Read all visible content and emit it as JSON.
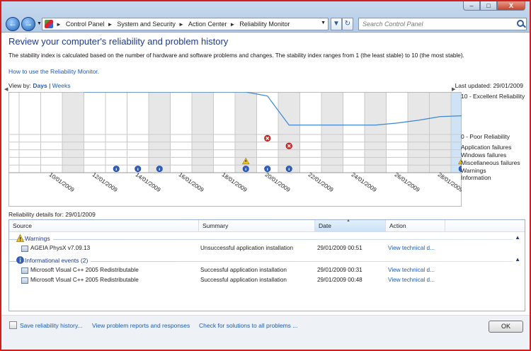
{
  "window": {
    "minimize_label": "–",
    "maximize_label": "□",
    "close_label": "X"
  },
  "navigation": {
    "back_icon": "back-arrow-icon",
    "forward_icon": "forward-arrow-icon",
    "breadcrumbs": [
      "Control Panel",
      "System and Security",
      "Action Center",
      "Reliability Monitor"
    ],
    "search_placeholder": "Search Control Panel"
  },
  "page": {
    "title": "Review your computer's reliability and problem history",
    "description": "The stability index is calculated based on the number of hardware and software problems and changes. The stability index ranges from 1 (the least stable) to 10 (the most stable).",
    "how_to_link": "How to use the Reliability Monitor.",
    "view_by_label": "View by:",
    "view_days": "Days",
    "view_separator": "|",
    "view_weeks": "Weeks",
    "last_updated": "Last updated: 29/01/2009"
  },
  "chart_data": {
    "type": "line",
    "ylim": [
      0,
      10
    ],
    "y_labels": {
      "top": "10 - Excellent Reliability",
      "bottom": "0 - Poor Reliability"
    },
    "categories": [
      "09/01/2009",
      "10/01/2009",
      "11/01/2009",
      "12/01/2009",
      "13/01/2009",
      "14/01/2009",
      "15/01/2009",
      "16/01/2009",
      "17/01/2009",
      "18/01/2009",
      "19/01/2009",
      "20/01/2009",
      "21/01/2009",
      "22/01/2009",
      "23/01/2009",
      "24/01/2009",
      "25/01/2009",
      "26/01/2009",
      "27/01/2009",
      "28/01/2009",
      "29/01/2009"
    ],
    "tick_labels": [
      "10/01/2009",
      "12/01/2009",
      "14/01/2009",
      "16/01/2009",
      "18/01/2009",
      "20/01/2009",
      "22/01/2009",
      "24/01/2009",
      "26/01/2009",
      "28/01/2009"
    ],
    "series": [
      {
        "points": [
          [
            "12/01/2009",
            10
          ],
          [
            "13/01/2009",
            10
          ],
          [
            "14/01/2009",
            10
          ],
          [
            "15/01/2009",
            10
          ],
          [
            "16/01/2009",
            10
          ],
          [
            "17/01/2009",
            10
          ],
          [
            "18/01/2009",
            10
          ],
          [
            "19/01/2009",
            10
          ],
          [
            "20/01/2009",
            9.0
          ],
          [
            "21/01/2009",
            1.8
          ],
          [
            "22/01/2009",
            1.8
          ],
          [
            "23/01/2009",
            1.8
          ],
          [
            "24/01/2009",
            1.8
          ],
          [
            "25/01/2009",
            1.8
          ],
          [
            "26/01/2009",
            2.3
          ],
          [
            "27/01/2009",
            3.0
          ],
          [
            "28/01/2009",
            3.9
          ],
          [
            "29/01/2009",
            4.1
          ]
        ]
      }
    ],
    "event_rows": [
      "Application failures",
      "Windows failures",
      "Miscellaneous failures",
      "Warnings",
      "Information"
    ],
    "events": [
      {
        "date": "20/01/2009",
        "row": "Application failures",
        "kind": "error"
      },
      {
        "date": "21/01/2009",
        "row": "Windows failures",
        "kind": "error"
      },
      {
        "date": "19/01/2009",
        "row": "Warnings",
        "kind": "warning"
      },
      {
        "date": "29/01/2009",
        "row": "Warnings",
        "kind": "warning"
      },
      {
        "date": "13/01/2009",
        "row": "Information",
        "kind": "info"
      },
      {
        "date": "14/01/2009",
        "row": "Information",
        "kind": "info"
      },
      {
        "date": "15/01/2009",
        "row": "Information",
        "kind": "info"
      },
      {
        "date": "19/01/2009",
        "row": "Information",
        "kind": "info"
      },
      {
        "date": "20/01/2009",
        "row": "Information",
        "kind": "info"
      },
      {
        "date": "21/01/2009",
        "row": "Information",
        "kind": "info"
      },
      {
        "date": "29/01/2009",
        "row": "Information",
        "kind": "info"
      }
    ],
    "selected": "29/01/2009",
    "shaded_columns": [
      "11/01/2009",
      "15/01/2009",
      "17/01/2009",
      "19/01/2009",
      "21/01/2009",
      "23/01/2009",
      "25/01/2009",
      "27/01/2009",
      "28/01/2009"
    ],
    "colors": {
      "line": "#3b86d4",
      "selected": "#cfe3f7",
      "shade": "#e7e7e7",
      "error": "#d42a2a",
      "warning": "#f2c418",
      "info": "#2f5fc4"
    }
  },
  "details": {
    "title": "Reliability details for: 29/01/2009",
    "columns": [
      "Source",
      "Summary",
      "Date",
      "Action"
    ],
    "groups": [
      {
        "label": "Warnings",
        "icon": "warning-icon",
        "rows": [
          {
            "source": "AGEIA PhysX v7.09.13",
            "summary": "Unsuccessful application installation",
            "date": "29/01/2009 00:51",
            "action": "View  technical d..."
          }
        ]
      },
      {
        "label": "Informational events (2)",
        "icon": "info-icon",
        "rows": [
          {
            "source": "Microsoft Visual C++ 2005 Redistributable",
            "summary": "Successful application installation",
            "date": "29/01/2009 00:31",
            "action": "View  technical d..."
          },
          {
            "source": "Microsoft Visual C++ 2005 Redistributable",
            "summary": "Successful application installation",
            "date": "29/01/2009 00:48",
            "action": "View  technical d..."
          }
        ]
      }
    ]
  },
  "footer": {
    "save_history": "Save reliability history...",
    "view_reports": "View problem reports and responses",
    "check_solutions": "Check for solutions to all problems ...",
    "ok": "OK"
  }
}
